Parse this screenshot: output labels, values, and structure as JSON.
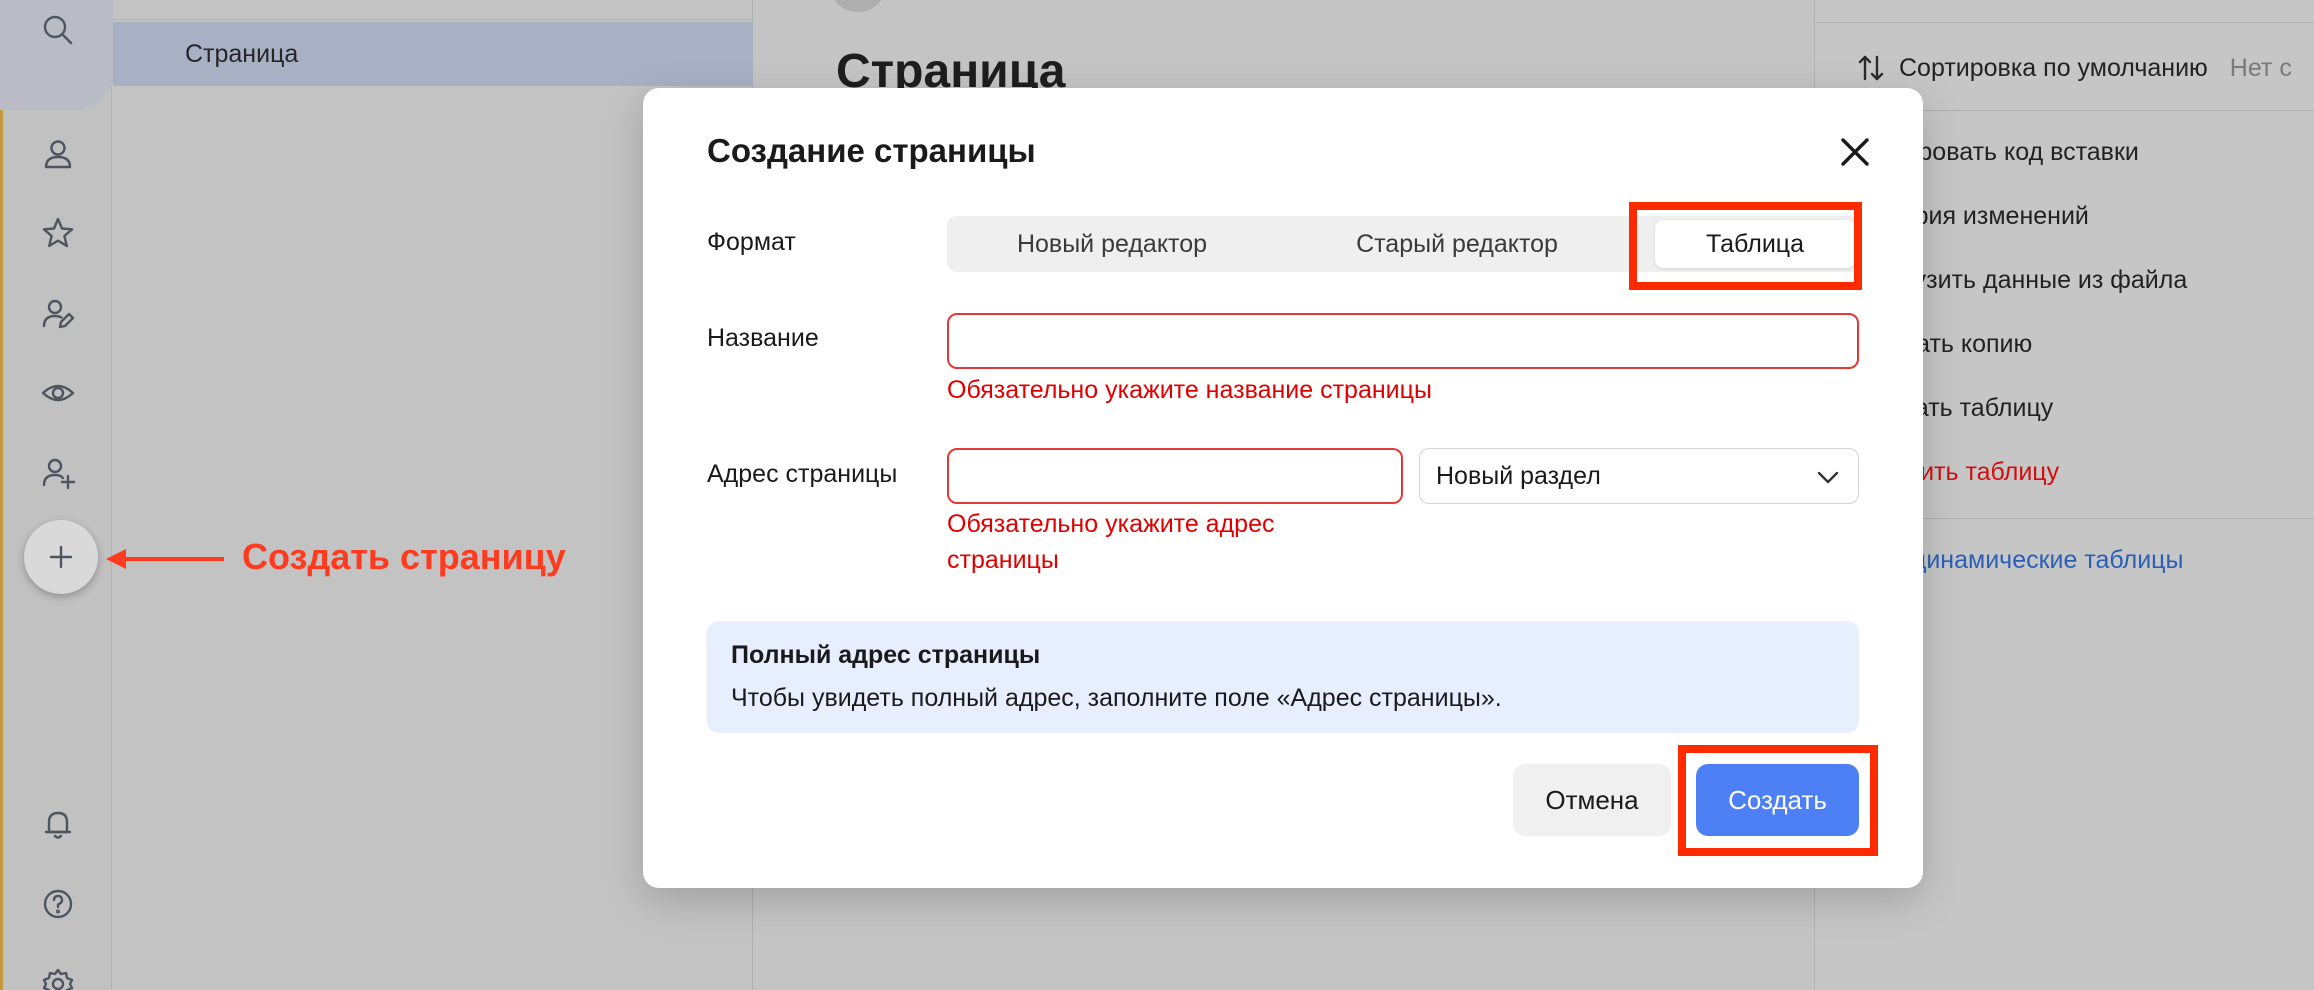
{
  "background": {
    "tree": {
      "active_item": "Страница"
    },
    "content": {
      "title": "Страница"
    },
    "right_panel": {
      "sort_label": "Сортировка по умолчанию",
      "sort_value": "Нет с",
      "menu": [
        {
          "label": "опировать код вставки"
        },
        {
          "label": "стория изменений"
        },
        {
          "label": "агрузить данные из файла"
        },
        {
          "label": "оздать копию"
        },
        {
          "label": "качать таблицу"
        },
        {
          "label": "далить таблицу"
        }
      ],
      "link": "ро динамические таблицы"
    }
  },
  "rail_icons": [
    "search-icon",
    "user-icon",
    "star-icon",
    "edit-user-icon",
    "eye-icon",
    "add-user-icon",
    "plus-icon",
    "bell-icon",
    "help-icon",
    "gear-icon"
  ],
  "annotation": {
    "text": "Создать страницу",
    "color": "#ff3b1f"
  },
  "modal": {
    "title": "Создание страницы",
    "format": {
      "label": "Формат",
      "options": [
        "Новый редактор",
        "Старый редактор",
        "Таблица"
      ],
      "selected": "Таблица"
    },
    "name": {
      "label": "Название",
      "value": "",
      "error": "Обязательно укажите название страницы"
    },
    "address": {
      "label": "Адрес страницы",
      "value": "",
      "error_line1": "Обязательно укажите адрес",
      "error_line2": "страницы",
      "section": "Новый раздел"
    },
    "info": {
      "title": "Полный адрес страницы",
      "text": "Чтобы увидеть полный адрес, заполните поле «Адрес страницы»."
    },
    "cancel_label": "Отмена",
    "create_label": "Создать"
  },
  "colors": {
    "accent": "#4d7ff5",
    "error": "#e00000",
    "highlight": "#ff2a00",
    "info_bg": "#e7eefe"
  }
}
